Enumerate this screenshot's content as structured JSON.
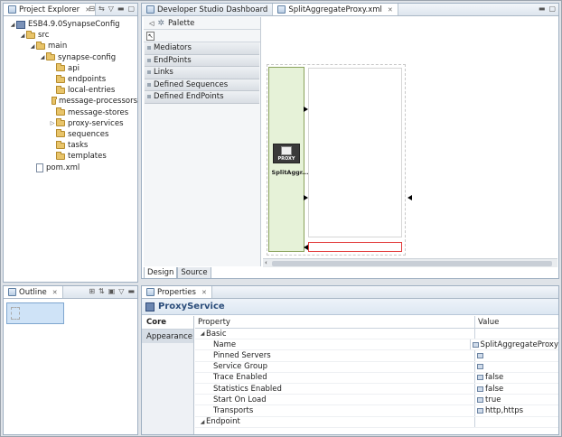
{
  "project_explorer": {
    "tab_label": "Project Explorer",
    "tree": [
      {
        "label": "ESB4.9.0SynapseConfig",
        "depth": 0,
        "kind": "project",
        "twisty": "expanded"
      },
      {
        "label": "src",
        "depth": 1,
        "kind": "folder",
        "twisty": "expanded"
      },
      {
        "label": "main",
        "depth": 2,
        "kind": "folder",
        "twisty": "expanded"
      },
      {
        "label": "synapse-config",
        "depth": 3,
        "kind": "folder",
        "twisty": "expanded"
      },
      {
        "label": "api",
        "depth": 4,
        "kind": "folder",
        "twisty": "none"
      },
      {
        "label": "endpoints",
        "depth": 4,
        "kind": "folder",
        "twisty": "none"
      },
      {
        "label": "local-entries",
        "depth": 4,
        "kind": "folder",
        "twisty": "none"
      },
      {
        "label": "message-processors",
        "depth": 4,
        "kind": "folder",
        "twisty": "none"
      },
      {
        "label": "message-stores",
        "depth": 4,
        "kind": "folder",
        "twisty": "none"
      },
      {
        "label": "proxy-services",
        "depth": 4,
        "kind": "folder",
        "twisty": "collapsed"
      },
      {
        "label": "sequences",
        "depth": 4,
        "kind": "folder",
        "twisty": "none"
      },
      {
        "label": "tasks",
        "depth": 4,
        "kind": "folder",
        "twisty": "none"
      },
      {
        "label": "templates",
        "depth": 4,
        "kind": "folder",
        "twisty": "none"
      },
      {
        "label": "pom.xml",
        "depth": 2,
        "kind": "file",
        "twisty": "none"
      }
    ]
  },
  "editor": {
    "tabs": [
      {
        "label": "Developer Studio Dashboard",
        "active": false
      },
      {
        "label": "SplitAggregateProxy.xml",
        "active": true
      }
    ],
    "palette": {
      "label": "Palette",
      "drawers": [
        "Mediators",
        "EndPoints",
        "Links",
        "Defined Sequences",
        "Defined EndPoints"
      ]
    },
    "proxy_badge": "PROXY",
    "proxy_name": "SplitAggr...",
    "bottom_tabs": [
      "Design",
      "Source"
    ]
  },
  "outline": {
    "tab_label": "Outline"
  },
  "properties": {
    "tab_label": "Properties",
    "title": "ProxyService",
    "side_tabs": [
      "Core",
      "Appearance"
    ],
    "columns": [
      "Property",
      "Value"
    ],
    "rows": [
      {
        "label": "Basic",
        "type": "group",
        "value": ""
      },
      {
        "label": "Name",
        "type": "prop",
        "value": "SplitAggregateProxy"
      },
      {
        "label": "Pinned Servers",
        "type": "prop",
        "value": ""
      },
      {
        "label": "Service Group",
        "type": "prop",
        "value": ""
      },
      {
        "label": "Trace Enabled",
        "type": "prop",
        "value": "false"
      },
      {
        "label": "Statistics Enabled",
        "type": "prop",
        "value": "false"
      },
      {
        "label": "Start On Load",
        "type": "prop",
        "value": "true"
      },
      {
        "label": "Transports",
        "type": "prop",
        "value": "http,https"
      },
      {
        "label": "Endpoint",
        "type": "group",
        "value": ""
      }
    ]
  },
  "colors": {
    "proxy_fill": "#e6f2d8",
    "proxy_border": "#8aa25c",
    "accent": "#2b4d7a",
    "error_outline": "#e23a3a"
  }
}
